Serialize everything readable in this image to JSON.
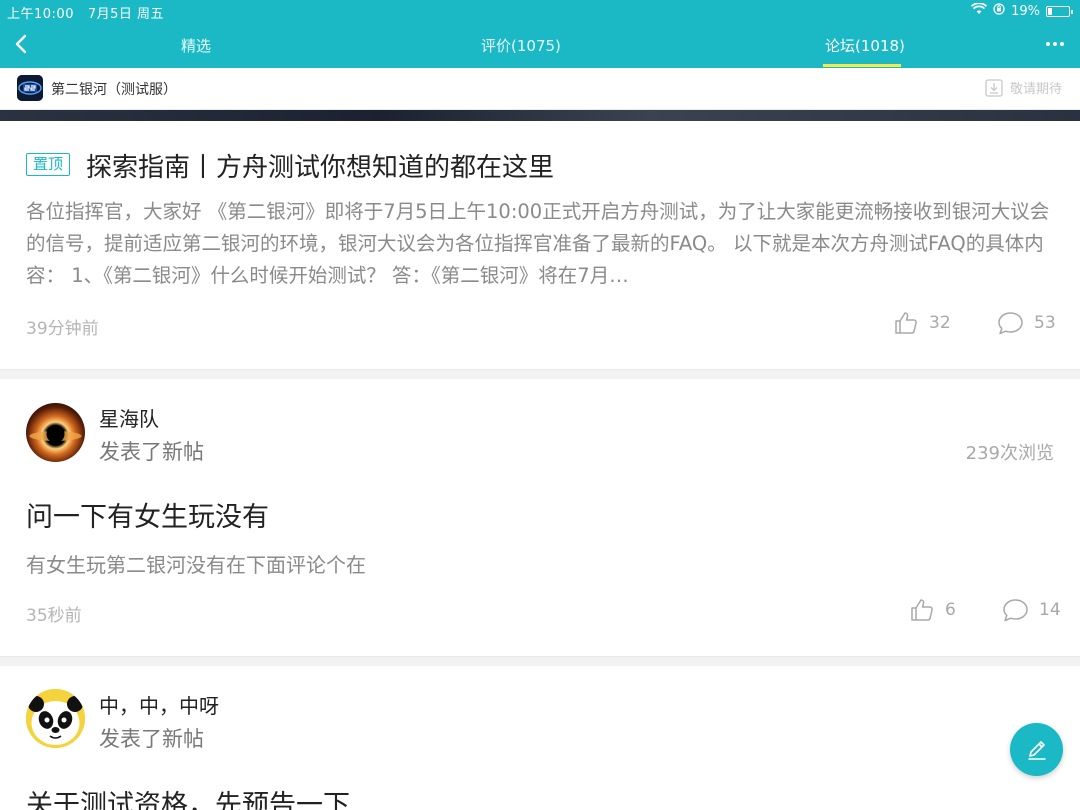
{
  "status_bar": {
    "time": "上午10:00",
    "date": "7月5日 周五",
    "battery_percent": "19%",
    "battery_level": 0.19
  },
  "nav": {
    "tabs": [
      {
        "label": "精选",
        "active": false
      },
      {
        "label": "评价(1075)",
        "active": false
      },
      {
        "label": "论坛(1018)",
        "active": true
      }
    ]
  },
  "game": {
    "name": "第二银河（测试服）",
    "reserve_label": "敬请期待"
  },
  "pinned_post": {
    "badge": "置顶",
    "title": "探索指南丨方舟测试你想知道的都在这里",
    "summary": "各位指挥官，大家好 《第二银河》即将于7月5日上午10:00正式开启方舟测试，为了让大家能更流畅接收到银河大议会的信号，提前适应第二银河的环境，银河大议会为各位指挥官准备了最新的FAQ。 以下就是本次方舟测试FAQ的具体内容： 1、《第二银河》什么时候开始测试？ 答：《第二银河》将在7月…",
    "time": "39分钟前",
    "likes": "32",
    "comments": "53"
  },
  "posts": [
    {
      "author": "星海队",
      "action": "发表了新帖",
      "views": "239次浏览",
      "title": "问一下有女生玩没有",
      "summary": "有女生玩第二银河没有在下面评论个在",
      "time": "35秒前",
      "likes": "6",
      "comments": "14"
    },
    {
      "author": "中，中，中呀",
      "action": "发表了新帖",
      "title": "关于测试资格，先预告一下"
    }
  ],
  "colors": {
    "accent": "#1ab9c5",
    "tab_indicator": "#f6e94a"
  }
}
